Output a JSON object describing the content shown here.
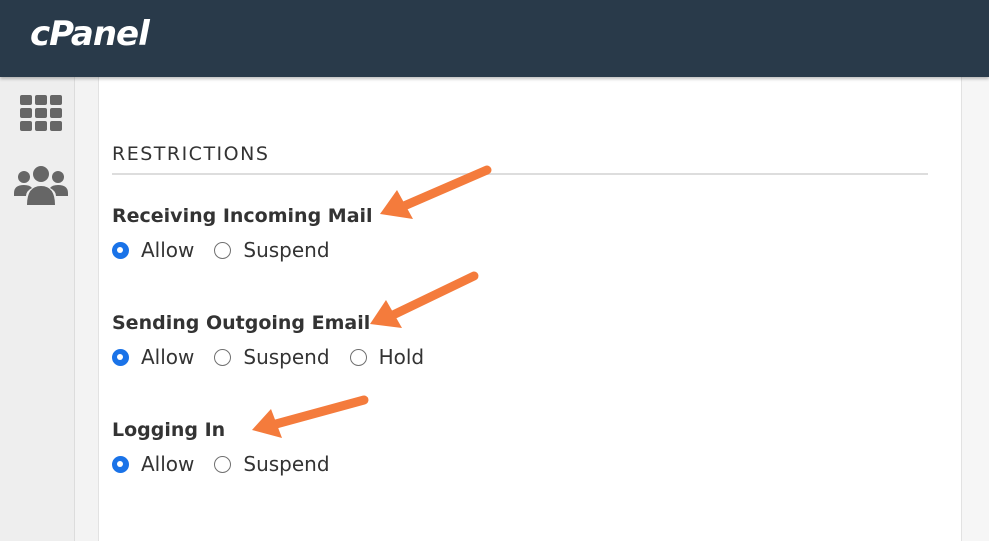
{
  "header": {
    "logo_text": "cPanel",
    "background": "#293a4a"
  },
  "sidebar": {
    "items": [
      {
        "icon": "grid-icon"
      },
      {
        "icon": "users-icon"
      }
    ]
  },
  "section": {
    "title": "RESTRICTIONS"
  },
  "groups": [
    {
      "label": "Receiving Incoming Mail",
      "options": [
        {
          "label": "Allow",
          "checked": true
        },
        {
          "label": "Suspend",
          "checked": false
        }
      ]
    },
    {
      "label": "Sending Outgoing Email",
      "options": [
        {
          "label": "Allow",
          "checked": true
        },
        {
          "label": "Suspend",
          "checked": false
        },
        {
          "label": "Hold",
          "checked": false
        }
      ]
    },
    {
      "label": "Logging In",
      "options": [
        {
          "label": "Allow",
          "checked": true
        },
        {
          "label": "Suspend",
          "checked": false
        }
      ]
    }
  ],
  "colors": {
    "accent": "#1a73e8",
    "annotation_arrow": "#f47b3c"
  }
}
